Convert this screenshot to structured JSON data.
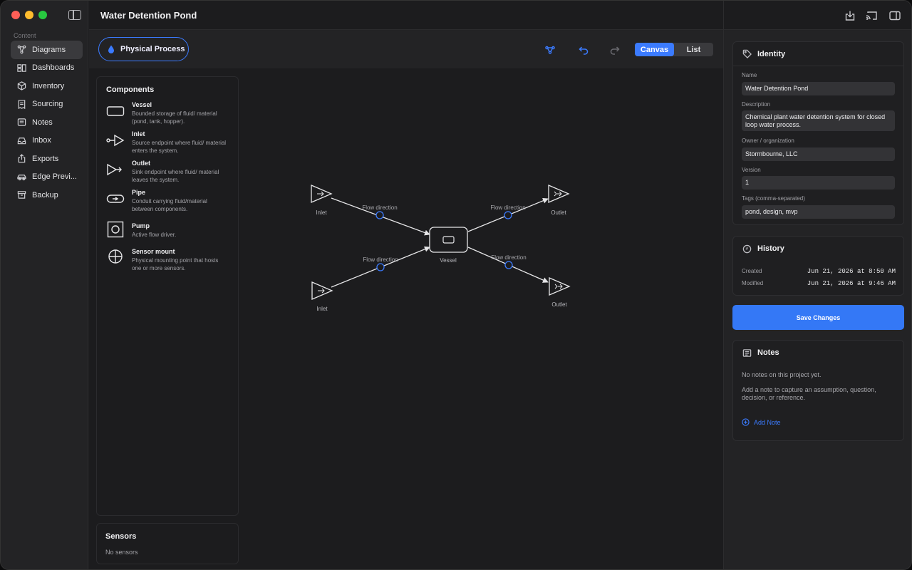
{
  "window": {
    "title": "Water Detention Pond"
  },
  "sidebar": {
    "section_label": "Content",
    "items": [
      {
        "label": "Diagrams",
        "icon": "diagram-icon",
        "active": true
      },
      {
        "label": "Dashboards",
        "icon": "dashboard-icon"
      },
      {
        "label": "Inventory",
        "icon": "cube-icon"
      },
      {
        "label": "Sourcing",
        "icon": "receipt-icon"
      },
      {
        "label": "Notes",
        "icon": "note-icon"
      },
      {
        "label": "Inbox",
        "icon": "inbox-icon"
      },
      {
        "label": "Exports",
        "icon": "export-icon"
      },
      {
        "label": "Edge Previ...",
        "icon": "car-icon"
      },
      {
        "label": "Backup",
        "icon": "archive-icon"
      }
    ]
  },
  "toolbar": {
    "process_label": "Physical Process",
    "view_canvas": "Canvas",
    "view_list": "List",
    "active_view": "Canvas"
  },
  "components": {
    "title": "Components",
    "items": [
      {
        "name": "Vessel",
        "description": "Bounded storage of fluid/ material (pond, tank, hopper).",
        "icon": "vessel-icon"
      },
      {
        "name": "Inlet",
        "description": "Source endpoint where fluid/ material enters the system.",
        "icon": "inlet-icon"
      },
      {
        "name": "Outlet",
        "description": "Sink endpoint where fluid/ material leaves the system.",
        "icon": "outlet-icon"
      },
      {
        "name": "Pipe",
        "description": "Conduit carrying fluid/material between components.",
        "icon": "pipe-icon"
      },
      {
        "name": "Pump",
        "description": "Active flow driver.",
        "icon": "pump-icon"
      },
      {
        "name": "Sensor mount",
        "description": "Physical mounting point that hosts one or more sensors.",
        "icon": "sensor-mount-icon"
      }
    ]
  },
  "sensors": {
    "title": "Sensors",
    "empty": "No sensors"
  },
  "diagram": {
    "nodes": {
      "inlet_top": "Inlet",
      "inlet_bottom": "Inlet",
      "vessel": "Vessel",
      "outlet_top": "Outlet",
      "outlet_bottom": "Outlet"
    },
    "edges": {
      "e1": "Flow direction",
      "e2": "Flow direction",
      "e3": "Flow direction",
      "e4": "Flow direction"
    }
  },
  "identity": {
    "title": "Identity",
    "name_label": "Name",
    "name_value": "Water Detention Pond",
    "description_label": "Description",
    "description_value": "Chemical plant water detention system for closed loop water process.",
    "owner_label": "Owner / organization",
    "owner_value": "Stormbourne, LLC",
    "version_label": "Version",
    "version_value": "1",
    "tags_label": "Tags (comma-separated)",
    "tags_value": "pond, design, mvp"
  },
  "history": {
    "title": "History",
    "created_label": "Created",
    "created_value": "Jun 21, 2026 at 8:50 AM",
    "modified_label": "Modified",
    "modified_value": "Jun 21, 2026 at 9:46 AM"
  },
  "save_label": "Save Changes",
  "notes": {
    "title": "Notes",
    "empty": "No notes on this project yet.",
    "hint": "Add a note to capture an assumption, question, decision, or reference.",
    "add_label": "Add Note"
  },
  "colors": {
    "accent": "#3b7bff",
    "background": "#1c1c1e"
  }
}
